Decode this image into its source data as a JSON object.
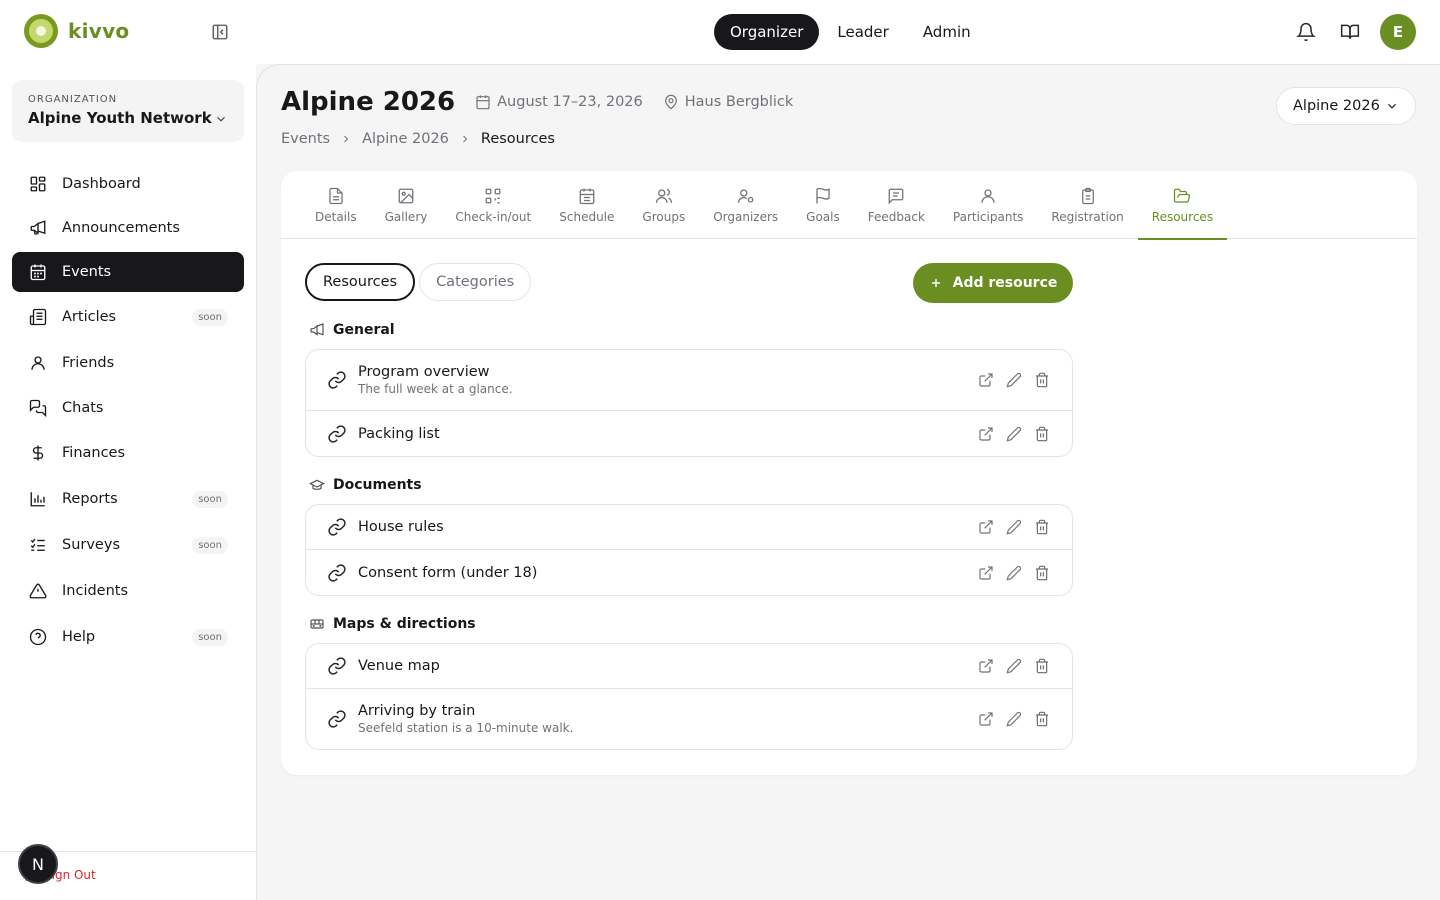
{
  "app": {
    "name": "kivvo"
  },
  "header": {
    "roles": [
      {
        "label": "Organizer",
        "active": true
      },
      {
        "label": "Leader",
        "active": false
      },
      {
        "label": "Admin",
        "active": false
      }
    ],
    "avatar_initial": "E"
  },
  "sidebar": {
    "org_label": "Organization",
    "org_name": "Alpine Youth Network",
    "items": [
      {
        "label": "Dashboard",
        "icon": "dashboard-icon"
      },
      {
        "label": "Announcements",
        "icon": "megaphone-icon"
      },
      {
        "label": "Events",
        "icon": "calendar-icon",
        "active": true
      },
      {
        "label": "Articles",
        "icon": "newspaper-icon",
        "badge": "soon"
      },
      {
        "label": "Friends",
        "icon": "user-icon"
      },
      {
        "label": "Chats",
        "icon": "chat-icon"
      },
      {
        "label": "Finances",
        "icon": "dollar-icon"
      },
      {
        "label": "Reports",
        "icon": "bar-chart-icon",
        "badge": "soon"
      },
      {
        "label": "Surveys",
        "icon": "checklist-icon",
        "badge": "soon"
      },
      {
        "label": "Incidents",
        "icon": "warning-icon"
      },
      {
        "label": "Help",
        "icon": "help-icon",
        "badge": "soon"
      }
    ],
    "signout_label": "Sign Out",
    "dev_badge": "N"
  },
  "page": {
    "title": "Alpine 2026",
    "date": "August 17–23, 2026",
    "location": "Haus Bergblick",
    "event_select": "Alpine 2026",
    "breadcrumb": [
      "Events",
      "Alpine 2026",
      "Resources"
    ]
  },
  "tabs": [
    {
      "label": "Details"
    },
    {
      "label": "Gallery"
    },
    {
      "label": "Check-in/out"
    },
    {
      "label": "Schedule"
    },
    {
      "label": "Groups"
    },
    {
      "label": "Organizers"
    },
    {
      "label": "Goals"
    },
    {
      "label": "Feedback"
    },
    {
      "label": "Participants"
    },
    {
      "label": "Registration"
    },
    {
      "label": "Resources",
      "active": true
    }
  ],
  "subtabs": [
    {
      "label": "Resources",
      "active": true
    },
    {
      "label": "Categories",
      "active": false
    }
  ],
  "add_button": "Add resource",
  "sections": [
    {
      "title": "General",
      "icon": "megaphone-icon",
      "items": [
        {
          "title": "Program overview",
          "desc": "The full week at a glance."
        },
        {
          "title": "Packing list",
          "desc": ""
        }
      ]
    },
    {
      "title": "Documents",
      "icon": "graduation-cap-icon",
      "items": [
        {
          "title": "House rules",
          "desc": ""
        },
        {
          "title": "Consent form (under 18)",
          "desc": ""
        }
      ]
    },
    {
      "title": "Maps & directions",
      "icon": "bus-icon",
      "items": [
        {
          "title": "Venue map",
          "desc": ""
        },
        {
          "title": "Arriving by train",
          "desc": "Seefeld station is a 10-minute walk."
        }
      ]
    }
  ],
  "colors": {
    "accent": "#6b8e23",
    "dark": "#18181b",
    "danger": "#dc2626"
  }
}
